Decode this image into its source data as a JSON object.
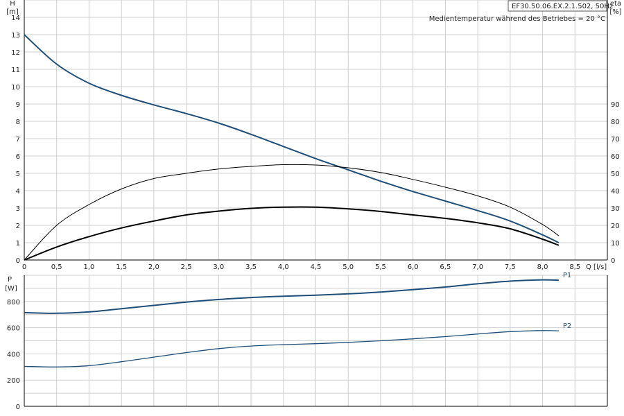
{
  "chart_data": [
    {
      "type": "line",
      "title": "EF30.50.06.EX.2.1.502, 50Hz",
      "subtitle": "Medientemperatur während des Betriebes = 20 °C",
      "xlabel": "Q [l/s]",
      "ylabel": "H",
      "ylabel_unit": "[m]",
      "y2label": "eta",
      "y2label_unit": "[%]",
      "xlim": [
        0,
        9
      ],
      "ylim": [
        0,
        15
      ],
      "y2lim": [
        0,
        150
      ],
      "grid": true,
      "x_ticks": [
        "0",
        "0,5",
        "1,0",
        "1,5",
        "2,0",
        "2,5",
        "3,0",
        "3,5",
        "4,0",
        "4,5",
        "5,0",
        "5,5",
        "6,0",
        "6,5",
        "7,0",
        "7,5",
        "8,0",
        "8,5"
      ],
      "y_ticks": [
        "0",
        "1",
        "2",
        "3",
        "4",
        "5",
        "6",
        "7",
        "8",
        "9",
        "10",
        "11",
        "12",
        "13",
        "14"
      ],
      "y2_ticks": [
        "0",
        "10",
        "20",
        "30",
        "40",
        "50",
        "60",
        "70",
        "80",
        "90"
      ],
      "series": [
        {
          "axis": "left",
          "color": "#1f4e79",
          "x": [
            0,
            0.5,
            1.0,
            1.5,
            2.0,
            2.5,
            3.0,
            3.5,
            4.0,
            4.5,
            5.0,
            5.5,
            6.0,
            6.5,
            7.0,
            7.5,
            8.0,
            8.25
          ],
          "values": [
            13.0,
            11.3,
            10.2,
            9.5,
            8.95,
            8.45,
            7.9,
            7.25,
            6.55,
            5.85,
            5.2,
            4.55,
            3.95,
            3.4,
            2.85,
            2.25,
            1.45,
            1.0
          ]
        },
        {
          "axis": "right",
          "color": "#000000",
          "x": [
            0,
            0.5,
            1.0,
            1.5,
            2.0,
            2.5,
            3.0,
            3.5,
            4.0,
            4.5,
            5.0,
            5.5,
            6.0,
            6.5,
            7.0,
            7.5,
            8.0,
            8.25
          ],
          "values": [
            0,
            20,
            32,
            41,
            47,
            50,
            52.5,
            54,
            55,
            54.8,
            53.2,
            50.5,
            46.5,
            42,
            37,
            30.5,
            20.5,
            14
          ]
        },
        {
          "axis": "left",
          "color": "#000000",
          "x": [
            0,
            0.5,
            1.0,
            1.5,
            2.0,
            2.5,
            3.0,
            3.5,
            4.0,
            4.5,
            5.0,
            5.5,
            6.0,
            6.5,
            7.0,
            7.5,
            8.0,
            8.25
          ],
          "values": [
            0,
            0.75,
            1.35,
            1.85,
            2.25,
            2.6,
            2.82,
            2.98,
            3.05,
            3.05,
            2.95,
            2.8,
            2.6,
            2.4,
            2.15,
            1.8,
            1.2,
            0.85
          ]
        }
      ]
    },
    {
      "type": "line",
      "ylabel": "P",
      "ylabel_unit": "[W]",
      "xlim": [
        0,
        9
      ],
      "ylim": [
        0,
        1000
      ],
      "grid": true,
      "y_ticks": [
        "0",
        "200",
        "400",
        "600",
        "800"
      ],
      "series": [
        {
          "name": "P1",
          "color": "#1f4e79",
          "x": [
            0,
            0.5,
            1.0,
            1.5,
            2.0,
            2.5,
            3.0,
            3.5,
            4.0,
            4.5,
            5.0,
            5.5,
            6.0,
            6.5,
            7.0,
            7.5,
            8.0,
            8.25
          ],
          "values": [
            715,
            710,
            720,
            745,
            770,
            795,
            815,
            830,
            840,
            848,
            858,
            872,
            890,
            910,
            935,
            955,
            965,
            962
          ]
        },
        {
          "name": "P2",
          "color": "#1f4e79",
          "x": [
            0,
            0.5,
            1.0,
            1.5,
            2.0,
            2.5,
            3.0,
            3.5,
            4.0,
            4.5,
            5.0,
            5.5,
            6.0,
            6.5,
            7.0,
            7.5,
            8.0,
            8.25
          ],
          "values": [
            305,
            300,
            310,
            340,
            375,
            410,
            440,
            460,
            470,
            478,
            488,
            500,
            515,
            532,
            552,
            570,
            578,
            576
          ]
        }
      ]
    }
  ]
}
